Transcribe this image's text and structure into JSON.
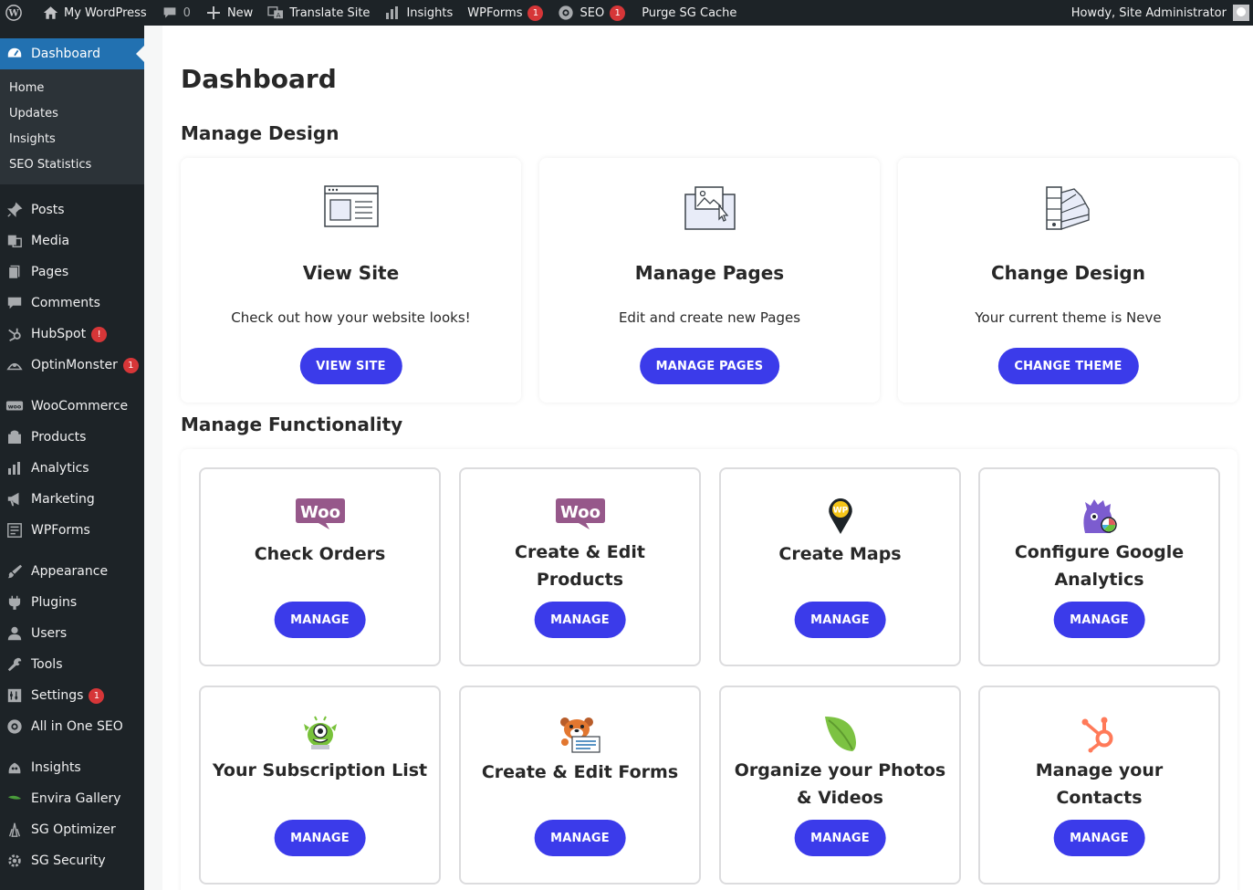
{
  "adminbar": {
    "site_name": "My WordPress",
    "comments_count": "0",
    "new_label": "New",
    "translate_label": "Translate Site",
    "insights_label": "Insights",
    "wpforms_label": "WPForms",
    "wpforms_badge": "1",
    "seo_label": "SEO",
    "seo_badge": "1",
    "purge_label": "Purge SG Cache",
    "howdy": "Howdy, Site Administrator"
  },
  "sidebar": {
    "current": "Dashboard",
    "submenu": [
      "Home",
      "Updates",
      "Insights",
      "SEO Statistics"
    ],
    "items": [
      {
        "label": "Posts",
        "icon": "pin-icon"
      },
      {
        "label": "Media",
        "icon": "media-icon"
      },
      {
        "label": "Pages",
        "icon": "pages-icon"
      },
      {
        "label": "Comments",
        "icon": "comment-icon"
      },
      {
        "label": "HubSpot",
        "icon": "hubspot-icon",
        "badge": "!"
      },
      {
        "label": "OptinMonster",
        "icon": "optinmonster-icon",
        "badge": "1"
      },
      {
        "label": "WooCommerce",
        "icon": "woo-icon"
      },
      {
        "label": "Products",
        "icon": "archive-icon"
      },
      {
        "label": "Analytics",
        "icon": "bar-chart-icon"
      },
      {
        "label": "Marketing",
        "icon": "megaphone-icon"
      },
      {
        "label": "WPForms",
        "icon": "form-icon"
      },
      {
        "label": "Appearance",
        "icon": "brush-icon"
      },
      {
        "label": "Plugins",
        "icon": "plug-icon"
      },
      {
        "label": "Users",
        "icon": "user-icon"
      },
      {
        "label": "Tools",
        "icon": "wrench-icon"
      },
      {
        "label": "Settings",
        "icon": "settings-icon",
        "badge": "1"
      },
      {
        "label": "All in One SEO",
        "icon": "aioseo-icon"
      },
      {
        "label": "Insights",
        "icon": "insights-icon"
      },
      {
        "label": "Envira Gallery",
        "icon": "leaf-icon"
      },
      {
        "label": "SG Optimizer",
        "icon": "sg-optimizer-icon"
      },
      {
        "label": "SG Security",
        "icon": "sg-security-icon"
      }
    ]
  },
  "main": {
    "title": "Dashboard",
    "design_heading": "Manage Design",
    "functionality_heading": "Manage Functionality",
    "design_cards": [
      {
        "title": "View Site",
        "desc": "Check out how your website looks!",
        "button": "VIEW SITE",
        "icon": "browser-window-icon"
      },
      {
        "title": "Manage Pages",
        "desc": "Edit and create new Pages",
        "button": "MANAGE PAGES",
        "icon": "image-page-icon"
      },
      {
        "title": "Change Design",
        "desc": "Your current theme is Neve",
        "button": "CHANGE THEME",
        "icon": "color-swatch-icon"
      }
    ],
    "function_cards": [
      {
        "title": "Check Orders",
        "button": "MANAGE",
        "icon": "woo-logo-icon"
      },
      {
        "title": "Create & Edit Products",
        "button": "MANAGE",
        "icon": "woo-logo-icon"
      },
      {
        "title": "Create Maps",
        "button": "MANAGE",
        "icon": "map-pin-icon"
      },
      {
        "title": "Configure Google Analytics",
        "button": "MANAGE",
        "icon": "monster-insights-icon"
      },
      {
        "title": "Your Subscription List",
        "button": "MANAGE",
        "icon": "optinmonster-mascot-icon"
      },
      {
        "title": "Create & Edit Forms",
        "button": "MANAGE",
        "icon": "wpforms-bear-icon"
      },
      {
        "title": "Organize your Photos & Videos",
        "button": "MANAGE",
        "icon": "envira-leaf-icon"
      },
      {
        "title": "Manage your Contacts",
        "button": "MANAGE",
        "icon": "hubspot-sprocket-icon"
      }
    ]
  },
  "colors": {
    "adminbar": "#1d2327",
    "sidebar": "#1d2327",
    "current": "#2271b1",
    "button": "#3b3bea",
    "badge": "#d63638",
    "woo_purple": "#96588a",
    "hubspot_orange": "#ff7a59"
  }
}
